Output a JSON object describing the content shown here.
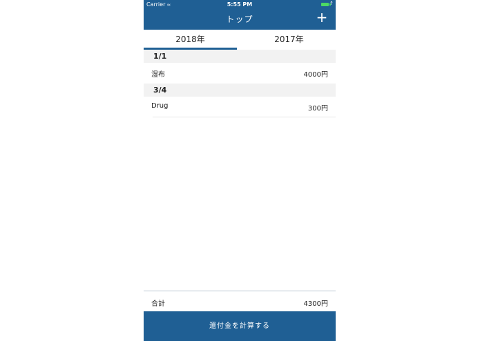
{
  "status_bar": {
    "carrier": "Carrier",
    "wifi_icon": "wifi-icon",
    "time": "5:55 PM",
    "battery_icon": "battery-icon"
  },
  "nav": {
    "title": "トップ",
    "add_icon": "+"
  },
  "tabs": [
    {
      "label": "2018年",
      "selected": true
    },
    {
      "label": "2017年",
      "selected": false
    }
  ],
  "sections": [
    {
      "header": "1/1",
      "items": [
        {
          "name": "湿布",
          "amount": "4000円"
        }
      ]
    },
    {
      "header": "3/4",
      "items": [
        {
          "name": "Drug",
          "amount": "300円"
        }
      ]
    }
  ],
  "total": {
    "label": "合計",
    "value": "4300円"
  },
  "calc_button": {
    "label": "還付金を計算する"
  },
  "colors": {
    "primary": "#1f5f94",
    "section_bg": "#f2f2f2",
    "battery": "#4cd964"
  }
}
